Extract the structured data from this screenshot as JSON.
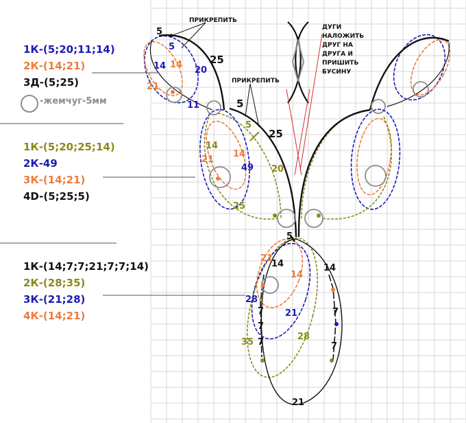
{
  "colors": {
    "black": "#111111",
    "blue": "#1b1bb5",
    "orange": "#ee7b3a",
    "olive": "#8a8a1c",
    "gray": "#8c8c8c",
    "red": "#d43030",
    "grid": "#d6d6d6"
  },
  "legend": {
    "group1": {
      "line1": "1К-(5;20;11;14)",
      "line2": "2К-(14;21)",
      "line3": "3Д-(5;25)",
      "pearl": "-жемчуг-5мм"
    },
    "group2": {
      "line1": "1К-(5;20;25;14)",
      "line2": "2К-49",
      "line3": "3К-(14;21)",
      "line4": "4D-(5;25;5)"
    },
    "group3": {
      "line1": "1К-(14;7;7;21;7;7;14)",
      "line2": "2К-(28;35)",
      "line3": "3К-(21;28)",
      "line4": "4К-(14;21)"
    }
  },
  "notes": {
    "attach_top": "ПРИКРЕПИТЬ",
    "attach_mid": "ПРИКРЕПИТЬ",
    "arcs_overlay": [
      "ДУГИ",
      "НАЛОЖИТЬ",
      "ДРУГ НА",
      "ДРУГА И",
      "ПРИШИТЬ",
      "БУСИНУ"
    ]
  },
  "labels": {
    "top_5": "5",
    "top_5_blue": "5",
    "top_25": "25",
    "top_20": "20",
    "top_14_blue": "14",
    "top_14_orange": "14",
    "top_21": "21",
    "top_11": "11",
    "mid_5": "5",
    "mid_5_olive": "5",
    "mid_25": "25",
    "mid_14_olive": "14",
    "mid_14_orange": "14",
    "mid_21": "21",
    "mid_49": "49",
    "mid_20": "20",
    "mid_25_olive": "25",
    "low_5": "5",
    "low_21_orange": "21",
    "low_14_black": "14",
    "low_14_orange": "14",
    "low_28_blue": "28",
    "low_7a": "7",
    "low_21_blue": "21",
    "low_7b": "7",
    "low_35": "35",
    "low_28_olive": "28",
    "low_7c": "7",
    "right_14": "14",
    "right_7a": "7",
    "right_7b": "7",
    "bottom_21": "21"
  }
}
